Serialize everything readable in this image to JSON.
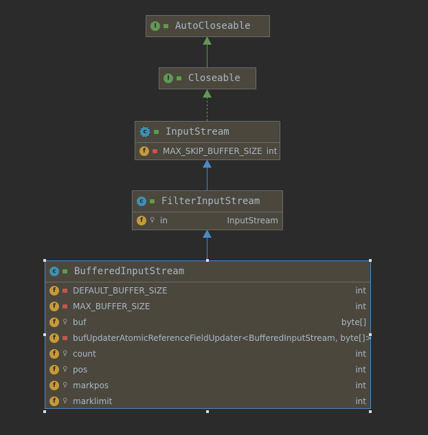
{
  "colors": {
    "implements": "#629755",
    "extends": "#4a88c7"
  },
  "classes": [
    {
      "name": "AutoCloseable",
      "kind": "interface",
      "fields": []
    },
    {
      "name": "Closeable",
      "kind": "interface",
      "fields": []
    },
    {
      "name": "InputStream",
      "kind": "abstract-class",
      "fields": [
        {
          "name": "MAX_SKIP_BUFFER_SIZE",
          "type": "int",
          "access": "private",
          "static": true
        }
      ]
    },
    {
      "name": "FilterInputStream",
      "kind": "class",
      "fields": [
        {
          "name": "in",
          "type": "InputStream",
          "access": "protected"
        }
      ]
    },
    {
      "name": "BufferedInputStream",
      "kind": "class",
      "fields": [
        {
          "name": "DEFAULT_BUFFER_SIZE",
          "type": "int",
          "access": "private",
          "static": true
        },
        {
          "name": "MAX_BUFFER_SIZE",
          "type": "int",
          "access": "private",
          "static": true
        },
        {
          "name": "buf",
          "type": "byte[]",
          "access": "protected"
        },
        {
          "name": "bufUpdater",
          "type": "AtomicReferenceFieldUpdater<BufferedInputStream, byte[]>",
          "access": "private",
          "static": true
        },
        {
          "name": "count",
          "type": "int",
          "access": "protected"
        },
        {
          "name": "pos",
          "type": "int",
          "access": "protected"
        },
        {
          "name": "markpos",
          "type": "int",
          "access": "protected"
        },
        {
          "name": "marklimit",
          "type": "int",
          "access": "protected"
        }
      ]
    }
  ],
  "icons": {
    "interface": "I",
    "class": "c",
    "field": "f"
  }
}
